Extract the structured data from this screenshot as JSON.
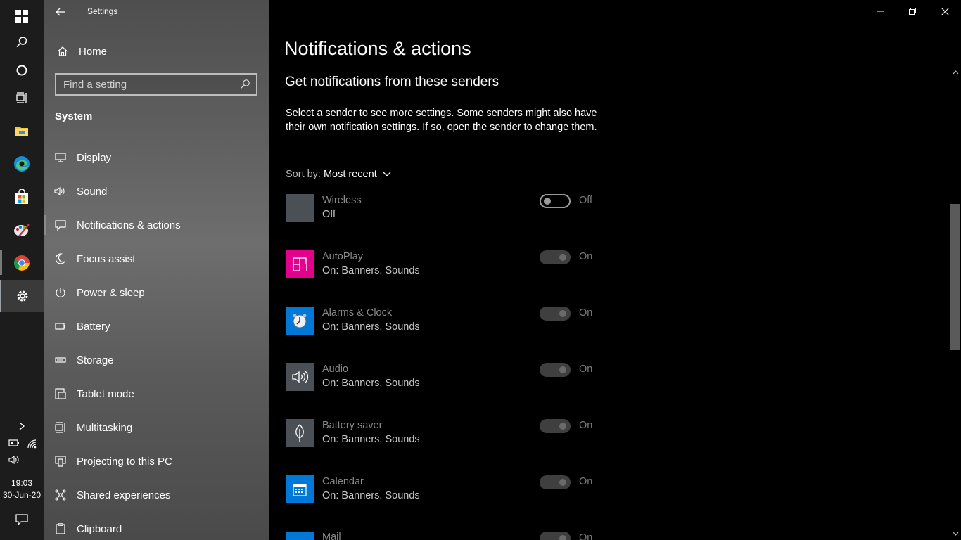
{
  "taskbar": {
    "icons": [
      "windows-icon",
      "search-icon",
      "cortana-icon",
      "task-view-icon",
      "file-explorer-icon",
      "edge-icon",
      "store-icon",
      "paint-icon",
      "chrome-icon",
      "settings-icon"
    ],
    "time": "19:03",
    "date": "30-Jun-20"
  },
  "window": {
    "title": "Settings"
  },
  "sidebar": {
    "home_label": "Home",
    "search_placeholder": "Find a setting",
    "section": "System",
    "items": [
      {
        "label": "Display",
        "icon": "display-icon"
      },
      {
        "label": "Sound",
        "icon": "sound-icon"
      },
      {
        "label": "Notifications & actions",
        "icon": "notifications-icon"
      },
      {
        "label": "Focus assist",
        "icon": "moon-icon"
      },
      {
        "label": "Power & sleep",
        "icon": "power-icon"
      },
      {
        "label": "Battery",
        "icon": "battery-icon"
      },
      {
        "label": "Storage",
        "icon": "storage-icon"
      },
      {
        "label": "Tablet mode",
        "icon": "tablet-icon"
      },
      {
        "label": "Multitasking",
        "icon": "multitasking-icon"
      },
      {
        "label": "Projecting to this PC",
        "icon": "projecting-icon"
      },
      {
        "label": "Shared experiences",
        "icon": "shared-icon"
      },
      {
        "label": "Clipboard",
        "icon": "clipboard-icon"
      }
    ],
    "selected_index": 2
  },
  "main": {
    "title": "Notifications & actions",
    "subheading": "Get notifications from these senders",
    "description": "Select a sender to see more settings. Some senders might also have their own notification settings. If so, open the sender to change them.",
    "sort_label": "Sort by:",
    "sort_value": "Most recent",
    "senders": [
      {
        "name": "Wireless",
        "status": "Off",
        "toggle": "Off",
        "tile_color": "#4a5056"
      },
      {
        "name": "AutoPlay",
        "status": "On: Banners, Sounds",
        "toggle": "On",
        "tile_color": "#e3008c"
      },
      {
        "name": "Alarms & Clock",
        "status": "On: Banners, Sounds",
        "toggle": "On",
        "tile_color": "#0078d7"
      },
      {
        "name": "Audio",
        "status": "On: Banners, Sounds",
        "toggle": "On",
        "tile_color": "#4a5056"
      },
      {
        "name": "Battery saver",
        "status": "On: Banners, Sounds",
        "toggle": "On",
        "tile_color": "#4a5056"
      },
      {
        "name": "Calendar",
        "status": "On: Banners, Sounds",
        "toggle": "On",
        "tile_color": "#0078d7"
      },
      {
        "name": "Mail",
        "status": "",
        "toggle": "On",
        "tile_color": "#0078d7"
      }
    ]
  }
}
